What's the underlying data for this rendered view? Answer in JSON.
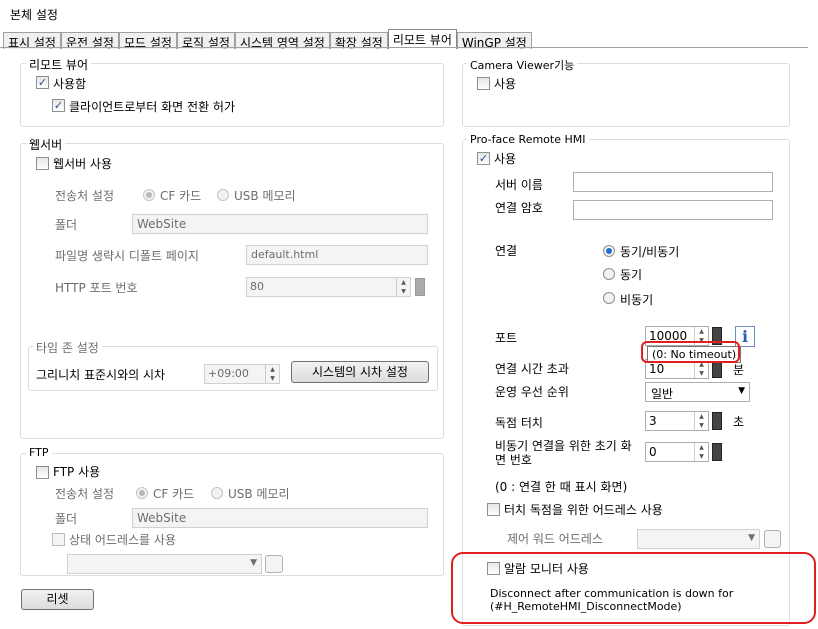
{
  "window": {
    "title": "본체 설정"
  },
  "tabs": [
    "표시 설정",
    "운전 설정",
    "모드 설정",
    "로직 설정",
    "시스템 영역 설정",
    "확장 설정",
    "리모트 뷰어",
    "WinGP 설정"
  ],
  "remote_viewer": {
    "label": "리모트 뷰어",
    "use": "사용함",
    "allow_switch": "클라이언트로부터 화면 전환 허가"
  },
  "webserver": {
    "label": "웹서버",
    "use": "웹서버 사용",
    "dest_label": "전송처 설정",
    "cf": "CF 카드",
    "usb": "USB 메모리",
    "folder_label": "폴더",
    "folder_value": "WebSite",
    "default_page_label": "파일명 생략시 디폴트 페이지",
    "default_page_value": "default.html",
    "http_port_label": "HTTP 포트 번호",
    "http_port_value": "80"
  },
  "timezone": {
    "label": "타임 존 설정",
    "greenwich_label": "그리니치 표준시와의 시차",
    "offset_value": "+09:00",
    "set_button": "시스템의 시차 설정"
  },
  "ftp": {
    "label": "FTP",
    "use": "FTP 사용",
    "dest_label": "전송처 설정",
    "cf": "CF 카드",
    "usb": "USB 메모리",
    "folder_label": "폴더",
    "folder_value": "WebSite",
    "status_address": "상태 어드레스를 사용"
  },
  "reset_button": "리셋",
  "camera_viewer": {
    "label": "Camera Viewer기능",
    "use": "사용"
  },
  "proface": {
    "label": "Pro-face Remote HMI",
    "use": "사용",
    "server_name_label": "서버 이름",
    "password_label": "연결 암호",
    "connection_label": "연결",
    "sync_async": "동기/비동기",
    "sync": "동기",
    "async": "비동기",
    "port_label": "포트",
    "port_value": "10000",
    "tooltip": "(0: No timeout)",
    "timeout_label": "연결 시간 초과",
    "timeout_value": "10",
    "timeout_unit": "분",
    "priority_label": "운영 우선 순위",
    "priority_value": "일반",
    "exclusive_label": "독점 터치",
    "exclusive_value": "3",
    "exclusive_unit": "초",
    "async_screen_label": "비동기 연결을 위한 초기 화면 번호",
    "async_screen_value": "0",
    "async_note": "(0 : 연결 한 때 표시 화면)",
    "touch_address": "터치 독점을 위한 어드레스 사용",
    "control_word_label": "제어 워드 어드레스",
    "alarm_monitor": "알람 모니터 사용",
    "disconnect_text": "Disconnect after communication is down for",
    "disconnect_var": "(#H_RemoteHMI_DisconnectMode)"
  }
}
